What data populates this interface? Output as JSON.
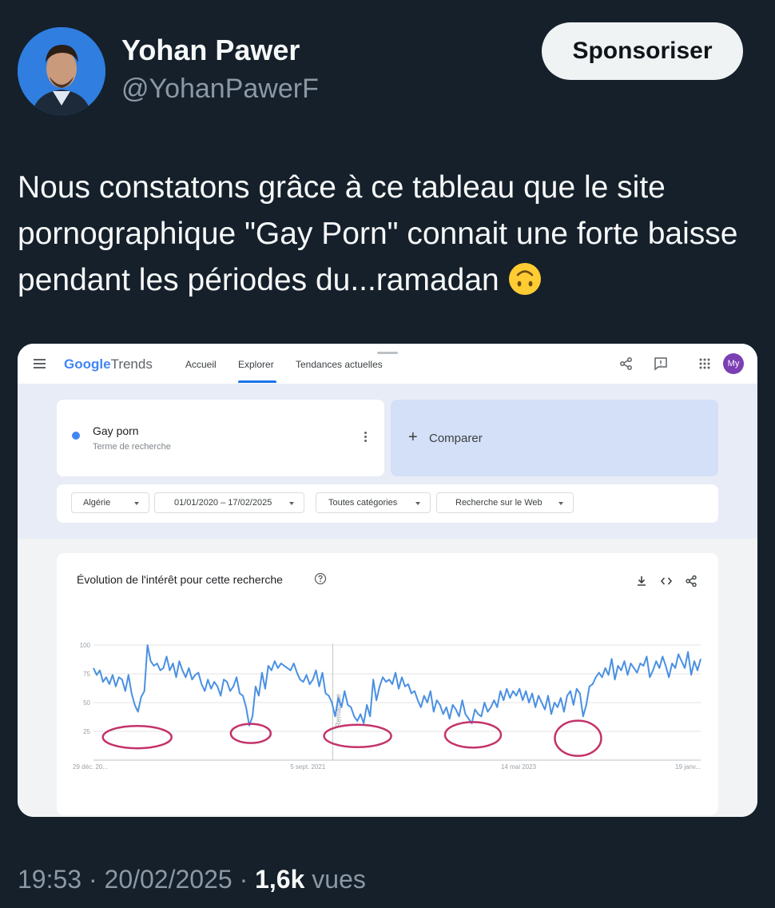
{
  "tweet": {
    "author_name": "Yohan Pawer",
    "author_handle": "@YohanPawerF",
    "action_button": "Sponsoriser",
    "text": "Nous constatons grâce à ce tableau que le site pornographique \"Gay Porn\" connait une forte baisse pendant les périodes du...ramadan",
    "emoji": "upside-down-face-icon",
    "time": "19:53",
    "date": "20/02/2025",
    "views_count": "1,6k",
    "views_label": "vues"
  },
  "trends": {
    "logo_google": "Google",
    "logo_trends": "Trends",
    "nav": [
      "Accueil",
      "Explorer",
      "Tendances actuelles"
    ],
    "active_nav": "Explorer",
    "user_initials": "My",
    "term_name": "Gay porn",
    "term_sub": "Terme de recherche",
    "compare_label": "Comparer",
    "filters": {
      "region": "Algérie",
      "period": "01/01/2020 – 17/02/2025",
      "category": "Toutes catégories",
      "search_type": "Recherche sur le Web"
    },
    "chart_title": "Évolution de l'intérêt pour cette recherche",
    "note_label": "Remarque"
  },
  "chart_data": {
    "type": "line",
    "title": "Évolution de l'intérêt pour cette recherche",
    "y_ticks": [
      "100",
      "75",
      "50",
      "25"
    ],
    "ylim": [
      0,
      100
    ],
    "x_ticks": [
      "29 déc. 20...",
      "5 sept. 2021",
      "14 mai 2023",
      "19 janv..."
    ],
    "series": [
      {
        "color": "#4a90e2",
        "values": [
          80,
          74,
          78,
          68,
          72,
          66,
          74,
          64,
          72,
          70,
          60,
          74,
          58,
          48,
          42,
          55,
          60,
          100,
          86,
          82,
          84,
          78,
          80,
          90,
          78,
          84,
          72,
          86,
          78,
          72,
          80,
          70,
          74,
          76,
          66,
          60,
          70,
          62,
          68,
          64,
          56,
          70,
          68,
          60,
          64,
          72,
          58,
          56,
          46,
          30,
          38,
          64,
          56,
          76,
          62,
          82,
          78,
          86,
          80,
          84,
          82,
          80,
          78,
          84,
          76,
          70,
          68,
          74,
          66,
          70,
          78,
          64,
          76,
          58,
          56,
          50,
          38,
          54,
          46,
          60,
          48,
          46,
          38,
          34,
          40,
          32,
          48,
          38,
          70,
          52,
          64,
          72,
          68,
          70,
          66,
          76,
          62,
          72,
          64,
          66,
          58,
          60,
          52,
          46,
          56,
          50,
          60,
          42,
          52,
          48,
          40,
          46,
          36,
          48,
          44,
          38,
          52,
          40,
          36,
          32,
          44,
          40,
          38,
          50,
          42,
          46,
          52,
          46,
          60,
          52,
          62,
          54,
          60,
          56,
          62,
          52,
          60,
          50,
          58,
          46,
          56,
          50,
          44,
          56,
          40,
          50,
          46,
          54,
          42,
          56,
          60,
          48,
          62,
          58,
          38,
          48,
          64,
          66,
          72,
          76,
          72,
          80,
          74,
          88,
          70,
          82,
          78,
          86,
          74,
          84,
          80,
          76,
          84,
          82,
          90,
          72,
          78,
          86,
          80,
          90,
          82,
          72,
          84,
          80,
          92,
          86,
          80,
          94,
          74,
          86,
          78,
          88
        ]
      }
    ],
    "circled_dips_count": 5
  }
}
